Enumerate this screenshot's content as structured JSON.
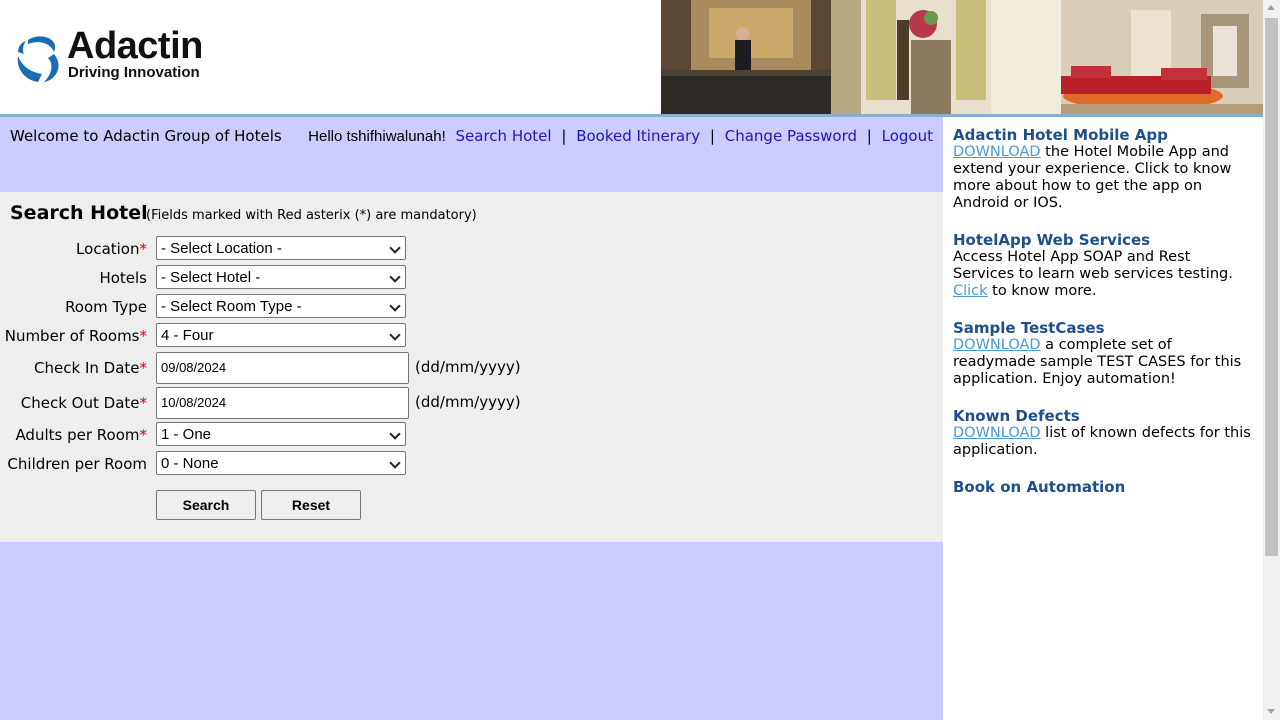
{
  "brand": {
    "name": "Adactin",
    "tagline": "Driving Innovation"
  },
  "nav": {
    "welcome": "Welcome to Adactin Group of Hotels",
    "hello": "Hello tshifhiwalunah!",
    "links": [
      "Search Hotel",
      "Booked Itinerary",
      "Change Password",
      "Logout"
    ],
    "separator": "|"
  },
  "form": {
    "title": "Search Hotel",
    "note": "(Fields marked with Red asterix (*) are mandatory)",
    "required_mark": "*",
    "fields": [
      {
        "label": "Location",
        "required": true,
        "value": "- Select Location -"
      },
      {
        "label": "Hotels",
        "required": false,
        "value": "- Select Hotel -"
      },
      {
        "label": "Room Type",
        "required": false,
        "value": "- Select Room Type -"
      },
      {
        "label": "Number of Rooms",
        "required": true,
        "value": "4 - Four"
      },
      {
        "label": "Check In Date",
        "required": true,
        "value": "09/08/2024",
        "hint": "(dd/mm/yyyy)"
      },
      {
        "label": "Check Out Date",
        "required": true,
        "value": "10/08/2024",
        "hint": "(dd/mm/yyyy)"
      },
      {
        "label": "Adults per Room",
        "required": true,
        "value": "1 - One"
      },
      {
        "label": "Children per Room",
        "required": false,
        "value": "0 - None"
      }
    ],
    "search_label": "Search",
    "reset_label": "Reset"
  },
  "sidebar": {
    "mobile": {
      "title": "Adactin Hotel Mobile App",
      "link": "DOWNLOAD",
      "text": " the Hotel Mobile App and extend your experience. Click to know more about how to get the app on Android or IOS."
    },
    "webservices": {
      "title": "HotelApp Web Services",
      "text_before": "Access Hotel App SOAP and Rest Services to learn web services testing. ",
      "link": "Click",
      "text_after": " to know more."
    },
    "testcases": {
      "title": "Sample TestCases",
      "link": "DOWNLOAD",
      "text": " a complete set of readymade sample TEST CASES for this application. Enjoy automation!"
    },
    "defects": {
      "title": "Known Defects",
      "link": "DOWNLOAD",
      "text": " list of known defects for this application."
    },
    "book": {
      "title": "Book on Automation"
    }
  },
  "colors": {
    "nav_bg": "#ccccff",
    "form_bg": "#eeeeee",
    "link": "#1a1ab8",
    "sidebar_title": "#1f4f8a",
    "required": "#dd0000"
  }
}
